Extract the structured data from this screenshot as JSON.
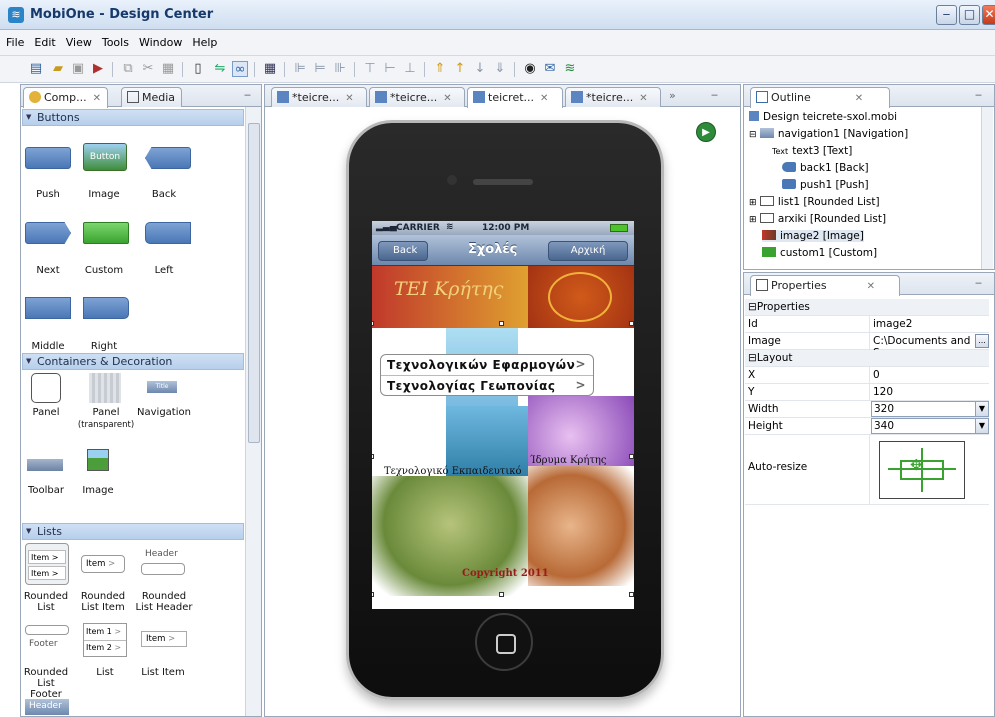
{
  "window": {
    "title": "MobiOne - Design Center",
    "minimize": "‒",
    "maximize": "□",
    "close": "✕"
  },
  "menu": [
    "File",
    "Edit",
    "View",
    "Tools",
    "Window",
    "Help"
  ],
  "palette": {
    "tabs": [
      {
        "label": "Comp...",
        "close": "✕"
      },
      {
        "label": "Media"
      }
    ],
    "minimize": "‒",
    "categories": {
      "buttons": "Buttons",
      "containers": "Containers & Decoration",
      "lists": "Lists",
      "header_peek": "Header"
    },
    "buttons": [
      "Push",
      "Image",
      "Back",
      "Next",
      "Custom",
      "Left",
      "Middle",
      "Right"
    ],
    "image_button_text": "Button",
    "containers": [
      "Panel",
      "Panel",
      "Navigation",
      "Toolbar",
      "Image"
    ],
    "panel_transparent_note": "(transparent)",
    "nav_thumb_text": "Title",
    "lists": [
      "Rounded List",
      "Rounded List Item",
      "Rounded List Header",
      "Rounded List Footer",
      "List",
      "List Item"
    ],
    "list_thumbs": {
      "item": "Item",
      "chev": ">",
      "header": "Header",
      "footer": "Footer",
      "item1": "Item 1",
      "item2": "Item 2"
    }
  },
  "editor": {
    "tabs": [
      {
        "label": "*teicre...",
        "close": "✕"
      },
      {
        "label": "*teicre...",
        "close": "✕"
      },
      {
        "label": "teicret...",
        "close": "✕"
      },
      {
        "label": "*teicre...",
        "close": "✕"
      }
    ],
    "more_tabs": "»",
    "minimize": "‒",
    "run_icon": "▶"
  },
  "phone": {
    "carrier": "CARRIER",
    "wifi": "≋",
    "time": "12:00 PM",
    "nav_back": "Back",
    "nav_title": "Σχολές",
    "nav_home": "Αρχική",
    "header_text": "ΤΕΙ Κρήτης",
    "list_items": [
      "Τεχνολογικών Εφαρμογών",
      "Τεχνολογίας Γεωπονίας"
    ],
    "chev": ">",
    "label_left": "Τεχνολογικό Εκπαιδευτικό",
    "label_right": "Ίδρυμα Κρήτης",
    "copyright": "Copyright 2011"
  },
  "outline": {
    "tab": "Outline",
    "close": "✕",
    "minimize": "‒",
    "root": "Design teicrete-sxol.mobi",
    "items": [
      "navigation1 [Navigation]",
      "text3 [Text]",
      "back1 [Back]",
      "push1 [Push]",
      "list1 [Rounded List]",
      "arxiki [Rounded List]",
      "image2 [Image]",
      "custom1 [Custom]"
    ],
    "text_icon": "Text",
    "expand_minus": "⊟",
    "expand_plus": "⊞"
  },
  "properties": {
    "tab": "Properties",
    "close": "✕",
    "minimize": "‒",
    "section_properties": "Properties",
    "section_layout": "Layout",
    "rows": [
      {
        "key": "Id",
        "value": "image2"
      },
      {
        "key": "Image",
        "value": "C:\\Documents and S..."
      },
      {
        "key": "X",
        "value": "0"
      },
      {
        "key": "Y",
        "value": "120"
      },
      {
        "key": "Width",
        "value": "320"
      },
      {
        "key": "Height",
        "value": "340"
      },
      {
        "key": "Auto-resize",
        "value": ""
      }
    ],
    "browse_button": "...",
    "dropdown_arrow": "▼",
    "collapse_sign": "⊟"
  },
  "colors": {
    "accent": "#2c84c8",
    "nav": "#6d88ad",
    "run": "#2e8b3a"
  }
}
